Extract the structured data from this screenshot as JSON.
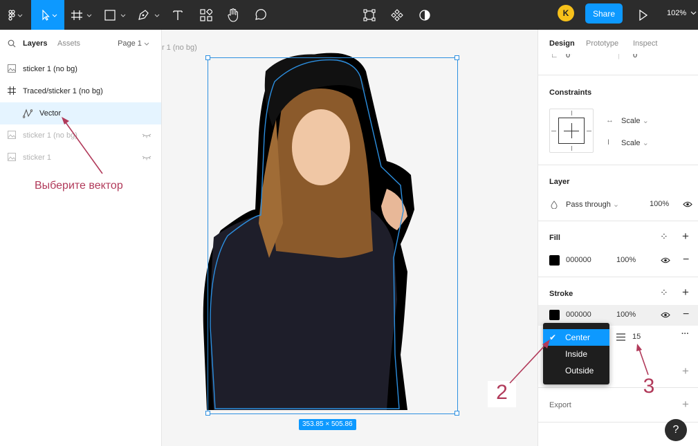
{
  "toolbar": {
    "zoom": "102%",
    "share_label": "Share",
    "avatar_initial": "K"
  },
  "left_panel": {
    "tabs": [
      "Layers",
      "Assets"
    ],
    "page": "Page 1",
    "layers": [
      {
        "label": "sticker 1 (no bg)",
        "icon": "image-icon"
      },
      {
        "label": "Traced/sticker 1 (no bg)",
        "icon": "frame-icon"
      },
      {
        "label": "Vector",
        "icon": "vector-icon"
      },
      {
        "label": "sticker 1 (no bg)",
        "icon": "image-icon"
      },
      {
        "label": "sticker 1",
        "icon": "image-icon"
      }
    ],
    "annotation": "Выберите вектор"
  },
  "canvas": {
    "frame_label": "r 1 (no bg)",
    "size_badge": "353.85 × 505.86"
  },
  "right_panel": {
    "tabs": [
      "Design",
      "Prototype",
      "Inspect"
    ],
    "top_values": {
      "a": "0°",
      "b": "0"
    },
    "constraints": {
      "title": "Constraints",
      "horizontal": "Scale",
      "vertical": "Scale"
    },
    "layer": {
      "title": "Layer",
      "blend": "Pass through",
      "opacity": "100%"
    },
    "fill": {
      "title": "Fill",
      "hex": "000000",
      "opacity": "100%",
      "color": "#000000"
    },
    "stroke": {
      "title": "Stroke",
      "hex": "000000",
      "opacity": "100%",
      "weight": "15",
      "color": "#000000"
    },
    "export": {
      "title": "Export"
    },
    "help": "?"
  },
  "stroke_align_menu": {
    "options": [
      "Center",
      "Inside",
      "Outside"
    ],
    "selected": "Center"
  },
  "annotations": {
    "two": "2",
    "three": "3"
  },
  "colors": {
    "accent": "#0d99ff",
    "annotation": "#b13a5a",
    "toolbar": "#2c2c2c"
  }
}
